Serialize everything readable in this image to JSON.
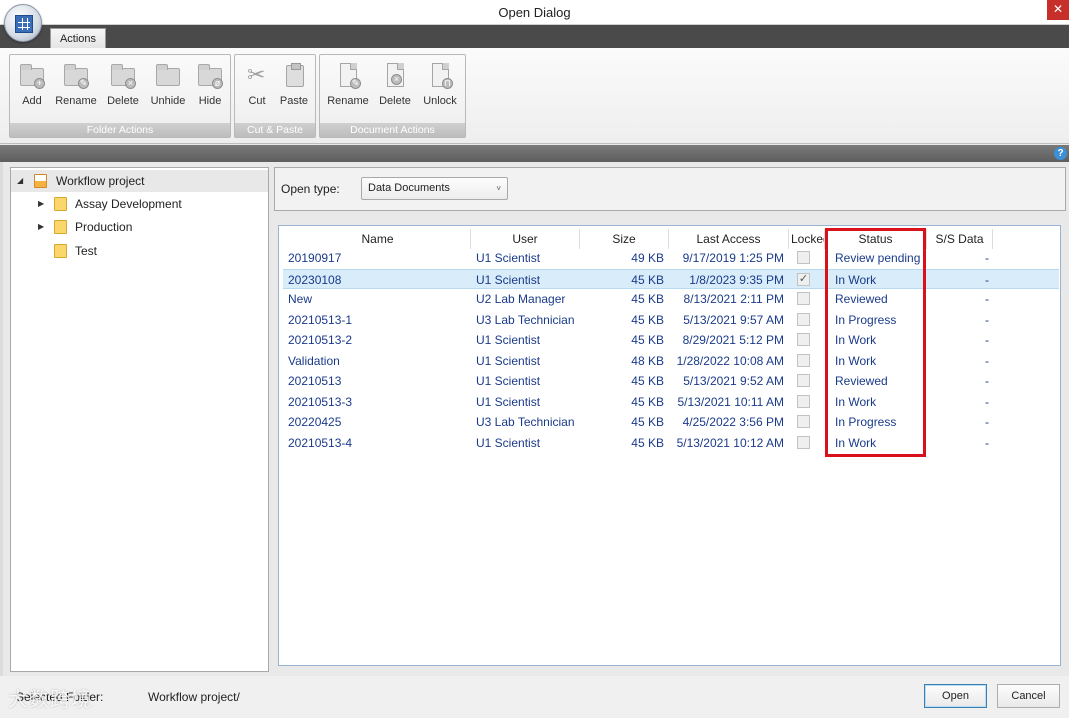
{
  "window": {
    "title": "Open Dialog",
    "close_glyph": "✕"
  },
  "ribbon": {
    "tab_label": "Actions",
    "groups": [
      {
        "label": "Folder Actions",
        "buttons": [
          {
            "label": "Add",
            "icon": "folder-add-icon"
          },
          {
            "label": "Rename",
            "icon": "folder-rename-icon"
          },
          {
            "label": "Delete",
            "icon": "folder-delete-icon"
          },
          {
            "label": "Unhide",
            "icon": "folder-unhide-icon"
          },
          {
            "label": "Hide",
            "icon": "folder-hide-icon"
          }
        ]
      },
      {
        "label": "Cut & Paste",
        "buttons": [
          {
            "label": "Cut",
            "icon": "scissors-icon"
          },
          {
            "label": "Paste",
            "icon": "clipboard-icon"
          }
        ]
      },
      {
        "label": "Document Actions",
        "buttons": [
          {
            "label": "Rename",
            "icon": "document-rename-icon"
          },
          {
            "label": "Delete",
            "icon": "document-delete-icon"
          },
          {
            "label": "Unlock",
            "icon": "document-unlock-icon"
          }
        ]
      }
    ]
  },
  "help_glyph": "?",
  "tree": {
    "root": {
      "label": "Workflow project",
      "expanded": true,
      "selected": true
    },
    "children": [
      {
        "label": "Assay Development",
        "has_children": true
      },
      {
        "label": "Production",
        "has_children": true
      },
      {
        "label": "Test",
        "has_children": false
      }
    ]
  },
  "open_type": {
    "label": "Open type:",
    "value": "Data Documents"
  },
  "grid": {
    "columns": [
      "Name",
      "User",
      "Size",
      "Last Access",
      "Locked",
      "Status",
      "S/S Data"
    ],
    "rows": [
      {
        "name": "20190917",
        "user": "U1 Scientist",
        "size": "49 KB",
        "last_access": "9/17/2019 1:25 PM",
        "locked": false,
        "status": "Review pending",
        "ss_data": "-"
      },
      {
        "name": "20230108",
        "user": "U1 Scientist",
        "size": "45 KB",
        "last_access": "1/8/2023 9:35 PM",
        "locked": true,
        "status": "In Work",
        "ss_data": "-",
        "selected": true
      },
      {
        "name": "New",
        "user": "U2 Lab Manager",
        "size": "45 KB",
        "last_access": "8/13/2021 2:11 PM",
        "locked": false,
        "status": "Reviewed",
        "ss_data": "-"
      },
      {
        "name": "20210513-1",
        "user": "U3 Lab Technician",
        "size": "45 KB",
        "last_access": "5/13/2021 9:57 AM",
        "locked": false,
        "status": "In Progress",
        "ss_data": "-"
      },
      {
        "name": "20210513-2",
        "user": "U1 Scientist",
        "size": "45 KB",
        "last_access": "8/29/2021 5:12 PM",
        "locked": false,
        "status": "In Work",
        "ss_data": "-"
      },
      {
        "name": "Validation",
        "user": "U1 Scientist",
        "size": "48 KB",
        "last_access": "1/28/2022 10:08 AM",
        "locked": false,
        "status": "In Work",
        "ss_data": "-"
      },
      {
        "name": "20210513",
        "user": "U1 Scientist",
        "size": "45 KB",
        "last_access": "5/13/2021 9:52 AM",
        "locked": false,
        "status": "Reviewed",
        "ss_data": "-"
      },
      {
        "name": "20210513-3",
        "user": "U1 Scientist",
        "size": "45 KB",
        "last_access": "5/13/2021 10:11 AM",
        "locked": false,
        "status": "In Work",
        "ss_data": "-"
      },
      {
        "name": "20220425",
        "user": "U3 Lab Technician",
        "size": "45 KB",
        "last_access": "4/25/2022 3:56 PM",
        "locked": false,
        "status": "In Progress",
        "ss_data": "-"
      },
      {
        "name": "20210513-4",
        "user": "U1 Scientist",
        "size": "45 KB",
        "last_access": "5/13/2021 10:12 AM",
        "locked": false,
        "status": "In Work",
        "ss_data": "-"
      }
    ]
  },
  "footer": {
    "selected_folder_label": "Selected Folder:",
    "selected_folder_value": "Workflow project/",
    "open_label": "Open",
    "cancel_label": "Cancel",
    "watermark": "大数跨境"
  },
  "colors": {
    "highlight_box": "#d9111b",
    "row_text": "#1a3a8a",
    "selected_row": "#d8ecf9"
  }
}
